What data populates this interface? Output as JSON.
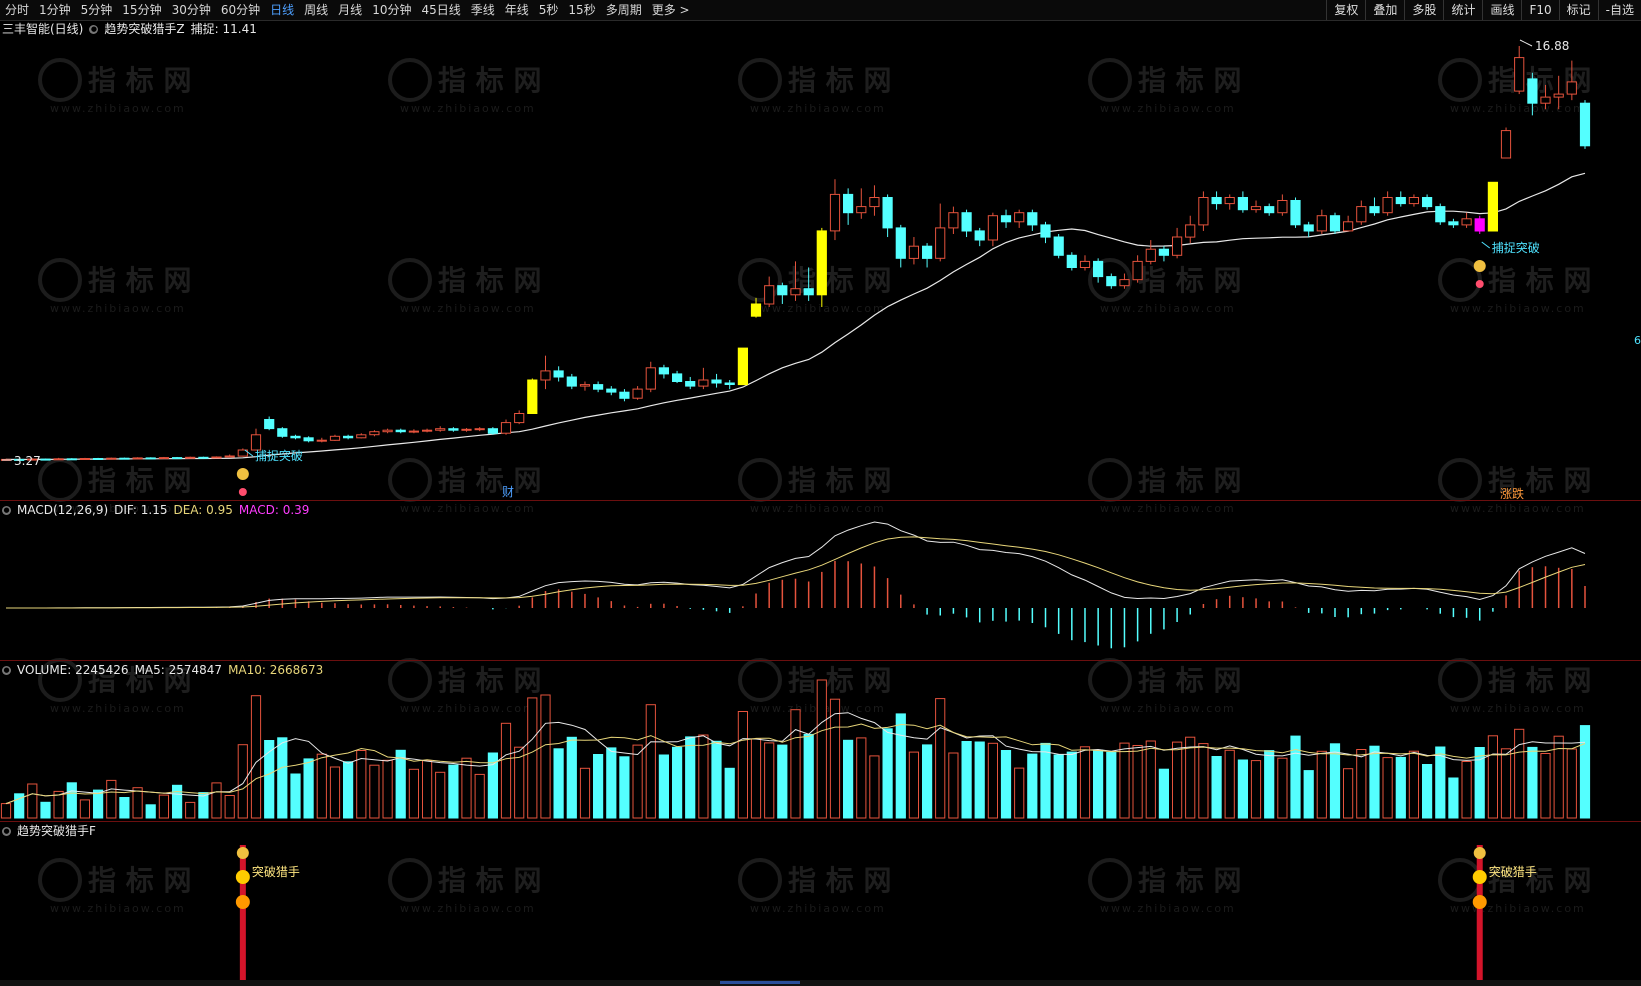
{
  "toolbar": {
    "periods": [
      "分时",
      "1分钟",
      "5分钟",
      "15分钟",
      "30分钟",
      "60分钟",
      "日线",
      "周线",
      "月线",
      "10分钟",
      "45日线",
      "季线",
      "年线",
      "5秒",
      "15秒",
      "多周期",
      "更多 >"
    ],
    "active_period": "日线",
    "tools": [
      "复权",
      "叠加",
      "多股",
      "统计",
      "画线",
      "F10",
      "标记",
      "-自选"
    ]
  },
  "main_panel": {
    "title": "三丰智能(日线)",
    "indicator_name": "趋势突破猎手Z",
    "capture_label": "捕捉",
    "capture_value": "11.41",
    "high_label": "16.88",
    "low_label": "3.27",
    "signal_text": "捕捉突破",
    "badge_finance": "财",
    "badge_limit": "涨跌",
    "right_edge_mark": "6"
  },
  "macd_panel": {
    "name": "MACD(12,26,9)",
    "dif_label": "DIF",
    "dif_value": "1.15",
    "dea_label": "DEA",
    "dea_value": "0.95",
    "macd_label": "MACD",
    "macd_value": "0.39"
  },
  "volume_panel": {
    "volume_label": "VOLUME",
    "volume_value": "2245426",
    "ma5_label": "MA5",
    "ma5_value": "2574847",
    "ma10_label": "MA10",
    "ma10_value": "2668673"
  },
  "signal_panel": {
    "name": "趋势突破猎手F",
    "signal_text": "突破猎手"
  },
  "watermark": {
    "brand": "指 标 网",
    "url": "www.zhibiaow.com"
  },
  "colors": {
    "up": "#e5533d",
    "down": "#54ffff",
    "signal_yellow": "#ffff00",
    "signal_magenta": "#ff00ff",
    "ma_line": "#e8e8e8",
    "dea_line": "#e8d67a",
    "separator": "#6b0f0f"
  },
  "chart_data": {
    "type": "candlestick",
    "price_high": 16.88,
    "price_low": 3.27,
    "candles": [
      {
        "o": 3.27,
        "c": 3.29,
        "h": 3.31,
        "l": 3.25
      },
      {
        "o": 3.29,
        "c": 3.28,
        "h": 3.32,
        "l": 3.26
      },
      {
        "o": 3.28,
        "c": 3.3,
        "h": 3.33,
        "l": 3.27
      },
      {
        "o": 3.3,
        "c": 3.29,
        "h": 3.32,
        "l": 3.27
      },
      {
        "o": 3.29,
        "c": 3.31,
        "h": 3.34,
        "l": 3.28
      },
      {
        "o": 3.31,
        "c": 3.3,
        "h": 3.33,
        "l": 3.28
      },
      {
        "o": 3.3,
        "c": 3.32,
        "h": 3.34,
        "l": 3.29
      },
      {
        "o": 3.32,
        "c": 3.31,
        "h": 3.34,
        "l": 3.29
      },
      {
        "o": 3.31,
        "c": 3.33,
        "h": 3.35,
        "l": 3.3
      },
      {
        "o": 3.33,
        "c": 3.32,
        "h": 3.35,
        "l": 3.3
      },
      {
        "o": 3.32,
        "c": 3.34,
        "h": 3.36,
        "l": 3.31
      },
      {
        "o": 3.34,
        "c": 3.33,
        "h": 3.36,
        "l": 3.31
      },
      {
        "o": 3.33,
        "c": 3.35,
        "h": 3.37,
        "l": 3.32
      },
      {
        "o": 3.35,
        "c": 3.34,
        "h": 3.37,
        "l": 3.32
      },
      {
        "o": 3.34,
        "c": 3.36,
        "h": 3.38,
        "l": 3.33
      },
      {
        "o": 3.36,
        "c": 3.35,
        "h": 3.38,
        "l": 3.33
      },
      {
        "o": 3.35,
        "c": 3.37,
        "h": 3.39,
        "l": 3.34
      },
      {
        "o": 3.37,
        "c": 3.4,
        "h": 3.45,
        "l": 3.36
      },
      {
        "o": 3.4,
        "c": 3.6,
        "h": 3.65,
        "l": 3.38
      },
      {
        "o": 3.6,
        "c": 4.1,
        "h": 4.3,
        "l": 3.58
      },
      {
        "o": 4.6,
        "c": 4.3,
        "h": 4.7,
        "l": 4.25
      },
      {
        "o": 4.3,
        "c": 4.05,
        "h": 4.35,
        "l": 4.0
      },
      {
        "o": 4.05,
        "c": 4.0,
        "h": 4.1,
        "l": 3.95
      },
      {
        "o": 4.0,
        "c": 3.9,
        "h": 4.05,
        "l": 3.85
      },
      {
        "o": 3.9,
        "c": 3.92,
        "h": 4.0,
        "l": 3.85
      },
      {
        "o": 3.92,
        "c": 4.05,
        "h": 4.1,
        "l": 3.9
      },
      {
        "o": 4.05,
        "c": 4.0,
        "h": 4.1,
        "l": 3.95
      },
      {
        "o": 4.0,
        "c": 4.1,
        "h": 4.15,
        "l": 3.98
      },
      {
        "o": 4.1,
        "c": 4.2,
        "h": 4.25,
        "l": 4.05
      },
      {
        "o": 4.2,
        "c": 4.25,
        "h": 4.3,
        "l": 4.15
      },
      {
        "o": 4.25,
        "c": 4.2,
        "h": 4.3,
        "l": 4.15
      },
      {
        "o": 4.2,
        "c": 4.22,
        "h": 4.28,
        "l": 4.15
      },
      {
        "o": 4.22,
        "c": 4.25,
        "h": 4.3,
        "l": 4.18
      },
      {
        "o": 4.25,
        "c": 4.3,
        "h": 4.38,
        "l": 4.2
      },
      {
        "o": 4.3,
        "c": 4.25,
        "h": 4.35,
        "l": 4.2
      },
      {
        "o": 4.25,
        "c": 4.28,
        "h": 4.32,
        "l": 4.2
      },
      {
        "o": 4.28,
        "c": 4.3,
        "h": 4.35,
        "l": 4.22
      },
      {
        "o": 4.3,
        "c": 4.15,
        "h": 4.35,
        "l": 4.1
      },
      {
        "o": 4.15,
        "c": 4.5,
        "h": 4.6,
        "l": 4.1
      },
      {
        "o": 4.5,
        "c": 4.8,
        "h": 4.9,
        "l": 4.45
      },
      {
        "o": 4.8,
        "c": 5.9,
        "h": 5.95,
        "l": 4.8
      },
      {
        "o": 5.9,
        "c": 6.2,
        "h": 6.7,
        "l": 5.6
      },
      {
        "o": 6.2,
        "c": 6.0,
        "h": 6.35,
        "l": 5.85
      },
      {
        "o": 6.0,
        "c": 5.7,
        "h": 6.1,
        "l": 5.6
      },
      {
        "o": 5.7,
        "c": 5.75,
        "h": 5.85,
        "l": 5.55
      },
      {
        "o": 5.75,
        "c": 5.6,
        "h": 5.85,
        "l": 5.5
      },
      {
        "o": 5.6,
        "c": 5.5,
        "h": 5.7,
        "l": 5.4
      },
      {
        "o": 5.5,
        "c": 5.3,
        "h": 5.6,
        "l": 5.2
      },
      {
        "o": 5.3,
        "c": 5.6,
        "h": 5.7,
        "l": 5.25
      },
      {
        "o": 5.6,
        "c": 6.3,
        "h": 6.5,
        "l": 5.5
      },
      {
        "o": 6.3,
        "c": 6.1,
        "h": 6.4,
        "l": 5.95
      },
      {
        "o": 6.1,
        "c": 5.85,
        "h": 6.2,
        "l": 5.8
      },
      {
        "o": 5.85,
        "c": 5.7,
        "h": 6.0,
        "l": 5.6
      },
      {
        "o": 5.7,
        "c": 5.9,
        "h": 6.3,
        "l": 5.6
      },
      {
        "o": 5.9,
        "c": 5.8,
        "h": 6.1,
        "l": 5.65
      },
      {
        "o": 5.8,
        "c": 5.75,
        "h": 5.9,
        "l": 5.6
      },
      {
        "o": 5.75,
        "c": 6.95,
        "h": 6.95,
        "l": 5.75
      },
      {
        "o": 8.0,
        "c": 8.4,
        "h": 8.6,
        "l": 7.95
      },
      {
        "o": 8.4,
        "c": 9.0,
        "h": 9.3,
        "l": 8.3
      },
      {
        "o": 9.0,
        "c": 8.7,
        "h": 9.1,
        "l": 8.4
      },
      {
        "o": 8.7,
        "c": 8.9,
        "h": 9.8,
        "l": 8.5
      },
      {
        "o": 8.9,
        "c": 8.7,
        "h": 9.6,
        "l": 8.5
      },
      {
        "o": 8.7,
        "c": 10.8,
        "h": 10.9,
        "l": 8.3
      },
      {
        "o": 10.8,
        "c": 12.0,
        "h": 12.5,
        "l": 10.5
      },
      {
        "o": 12.0,
        "c": 11.4,
        "h": 12.2,
        "l": 11.0
      },
      {
        "o": 11.4,
        "c": 11.6,
        "h": 12.2,
        "l": 11.2
      },
      {
        "o": 11.6,
        "c": 11.9,
        "h": 12.3,
        "l": 11.3
      },
      {
        "o": 11.9,
        "c": 10.9,
        "h": 12.0,
        "l": 10.6
      },
      {
        "o": 10.9,
        "c": 9.9,
        "h": 11.0,
        "l": 9.6
      },
      {
        "o": 9.9,
        "c": 10.3,
        "h": 10.6,
        "l": 9.7
      },
      {
        "o": 10.3,
        "c": 9.9,
        "h": 10.4,
        "l": 9.6
      },
      {
        "o": 9.9,
        "c": 10.9,
        "h": 11.7,
        "l": 9.8
      },
      {
        "o": 10.9,
        "c": 11.4,
        "h": 11.6,
        "l": 10.7
      },
      {
        "o": 11.4,
        "c": 10.8,
        "h": 11.5,
        "l": 10.6
      },
      {
        "o": 10.8,
        "c": 10.5,
        "h": 10.9,
        "l": 10.3
      },
      {
        "o": 10.5,
        "c": 11.3,
        "h": 11.4,
        "l": 10.3
      },
      {
        "o": 11.3,
        "c": 11.1,
        "h": 11.5,
        "l": 10.9
      },
      {
        "o": 11.1,
        "c": 11.4,
        "h": 11.5,
        "l": 10.9
      },
      {
        "o": 11.4,
        "c": 11.0,
        "h": 11.5,
        "l": 10.8
      },
      {
        "o": 11.0,
        "c": 10.6,
        "h": 11.1,
        "l": 10.4
      },
      {
        "o": 10.6,
        "c": 10.0,
        "h": 10.7,
        "l": 9.9
      },
      {
        "o": 10.0,
        "c": 9.6,
        "h": 10.1,
        "l": 9.5
      },
      {
        "o": 9.6,
        "c": 9.8,
        "h": 10.0,
        "l": 9.5
      },
      {
        "o": 9.8,
        "c": 9.3,
        "h": 9.9,
        "l": 9.1
      },
      {
        "o": 9.3,
        "c": 9.0,
        "h": 9.4,
        "l": 8.9
      },
      {
        "o": 9.0,
        "c": 9.2,
        "h": 9.4,
        "l": 8.9
      },
      {
        "o": 9.2,
        "c": 9.8,
        "h": 10.0,
        "l": 9.1
      },
      {
        "o": 9.8,
        "c": 10.2,
        "h": 10.5,
        "l": 9.7
      },
      {
        "o": 10.2,
        "c": 10.0,
        "h": 10.3,
        "l": 9.8
      },
      {
        "o": 10.0,
        "c": 10.6,
        "h": 10.9,
        "l": 9.9
      },
      {
        "o": 10.6,
        "c": 11.0,
        "h": 11.3,
        "l": 10.4
      },
      {
        "o": 11.0,
        "c": 11.9,
        "h": 12.1,
        "l": 10.8
      },
      {
        "o": 11.9,
        "c": 11.7,
        "h": 12.1,
        "l": 11.5
      },
      {
        "o": 11.7,
        "c": 11.9,
        "h": 12.0,
        "l": 11.5
      },
      {
        "o": 11.9,
        "c": 11.5,
        "h": 12.1,
        "l": 11.4
      },
      {
        "o": 11.5,
        "c": 11.6,
        "h": 11.8,
        "l": 11.4
      },
      {
        "o": 11.6,
        "c": 11.4,
        "h": 11.7,
        "l": 11.3
      },
      {
        "o": 11.4,
        "c": 11.8,
        "h": 12.0,
        "l": 11.3
      },
      {
        "o": 11.8,
        "c": 11.0,
        "h": 11.9,
        "l": 10.9
      },
      {
        "o": 11.0,
        "c": 10.8,
        "h": 11.1,
        "l": 10.6
      },
      {
        "o": 10.8,
        "c": 11.3,
        "h": 11.5,
        "l": 10.7
      },
      {
        "o": 11.3,
        "c": 10.8,
        "h": 11.4,
        "l": 10.7
      },
      {
        "o": 10.8,
        "c": 11.1,
        "h": 11.3,
        "l": 10.8
      },
      {
        "o": 11.1,
        "c": 11.6,
        "h": 11.8,
        "l": 11.0
      },
      {
        "o": 11.6,
        "c": 11.4,
        "h": 11.9,
        "l": 11.3
      },
      {
        "o": 11.4,
        "c": 11.9,
        "h": 12.1,
        "l": 11.3
      },
      {
        "o": 11.9,
        "c": 11.7,
        "h": 12.1,
        "l": 11.6
      },
      {
        "o": 11.7,
        "c": 11.9,
        "h": 12.0,
        "l": 11.6
      },
      {
        "o": 11.9,
        "c": 11.6,
        "h": 12.0,
        "l": 11.5
      },
      {
        "o": 11.6,
        "c": 11.1,
        "h": 11.7,
        "l": 11.0
      },
      {
        "o": 11.1,
        "c": 11.0,
        "h": 11.2,
        "l": 10.9
      },
      {
        "o": 11.0,
        "c": 11.2,
        "h": 11.4,
        "l": 10.9
      },
      {
        "o": 11.2,
        "c": 10.8,
        "h": 11.3,
        "l": 10.7
      },
      {
        "o": 10.8,
        "c": 12.4,
        "h": 12.4,
        "l": 10.8
      },
      {
        "o": 13.2,
        "c": 14.1,
        "h": 14.2,
        "l": 13.2
      },
      {
        "o": 15.4,
        "c": 16.5,
        "h": 16.88,
        "l": 15.3
      },
      {
        "o": 15.8,
        "c": 15.0,
        "h": 16.0,
        "l": 14.6
      },
      {
        "o": 15.0,
        "c": 15.2,
        "h": 15.6,
        "l": 14.8
      },
      {
        "o": 15.2,
        "c": 15.3,
        "h": 15.9,
        "l": 14.8
      },
      {
        "o": 15.3,
        "c": 15.7,
        "h": 16.4,
        "l": 15.1
      },
      {
        "o": 15.0,
        "c": 13.6,
        "h": 15.1,
        "l": 13.5
      }
    ],
    "capture_signals_at_index": [
      18,
      112
    ],
    "macd": {
      "dif": 1.15,
      "dea": 0.95,
      "macd": 0.39
    },
    "volume": {
      "last": 2245426,
      "ma5": 2574847,
      "ma10": 2668673
    }
  }
}
